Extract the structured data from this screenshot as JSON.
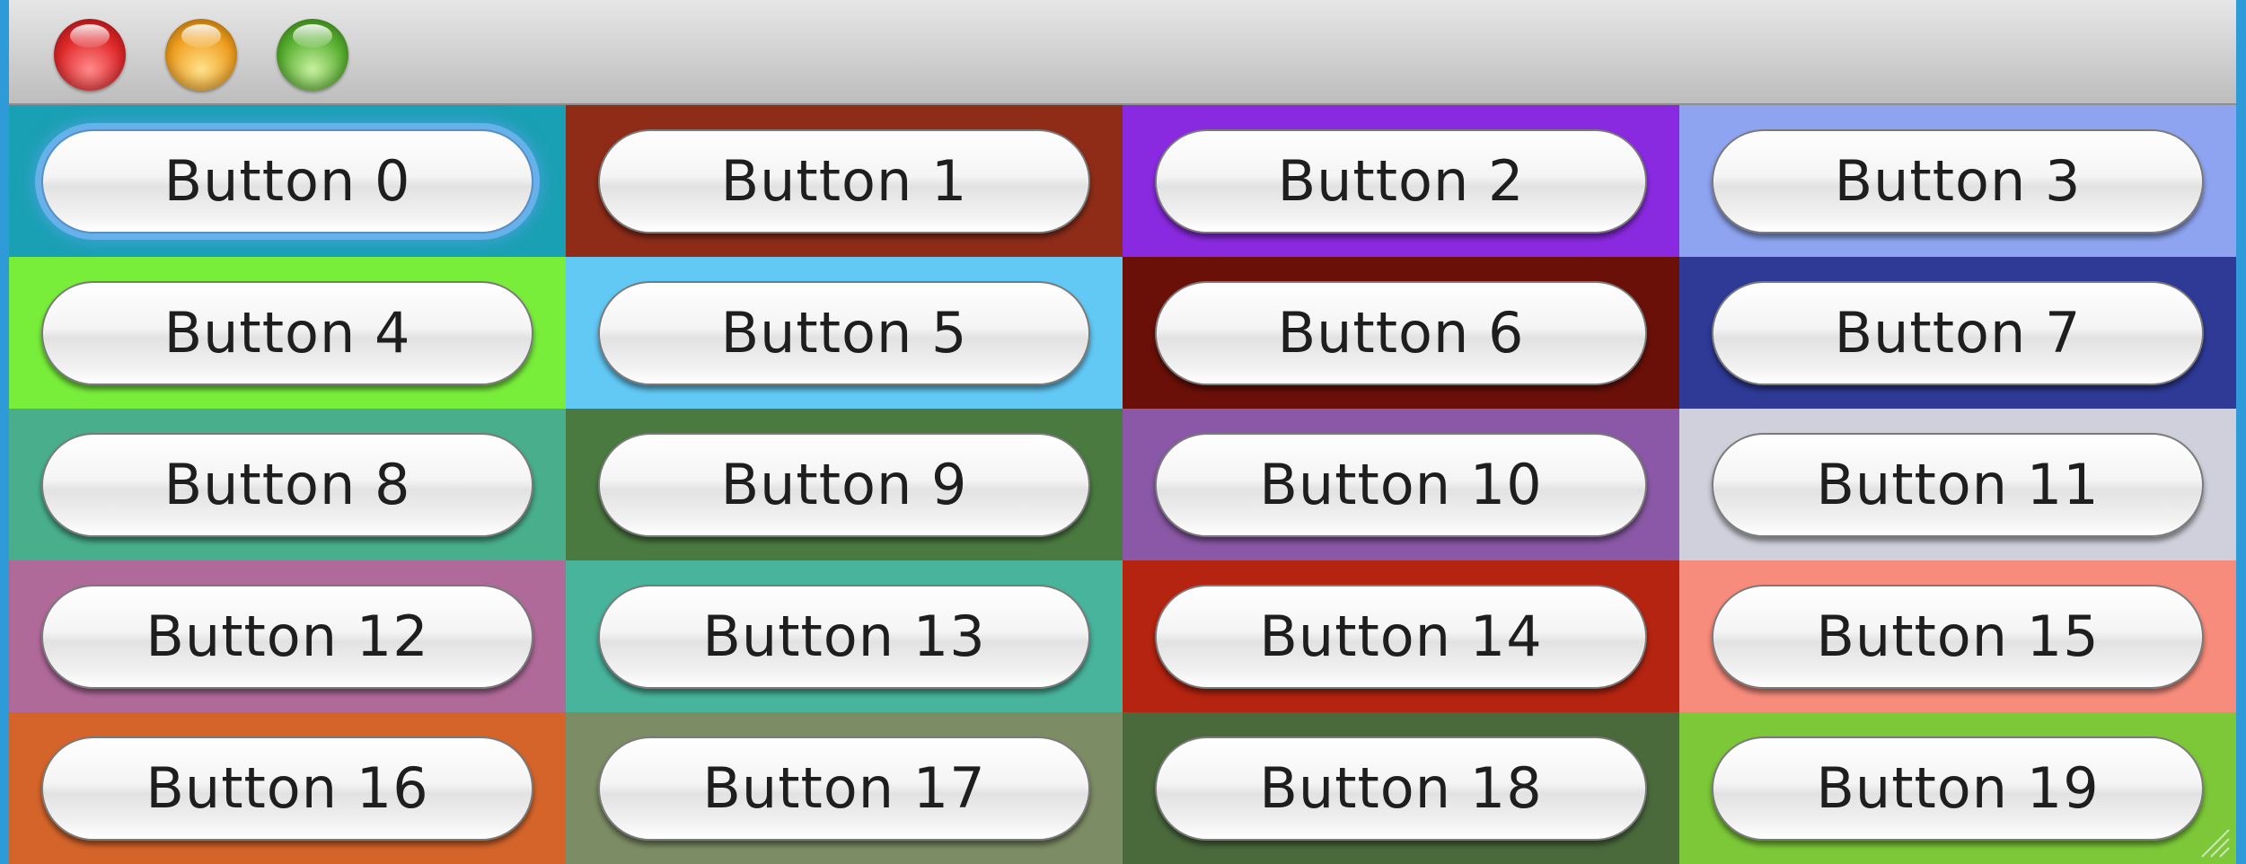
{
  "window": {
    "controls": [
      {
        "name": "close",
        "color": "#e0282a"
      },
      {
        "name": "minimize",
        "color": "#f0a020"
      },
      {
        "name": "zoom",
        "color": "#58b030"
      }
    ]
  },
  "focused_index": 0,
  "buttons": [
    {
      "label": "Button 0",
      "bg": "#1aa0b4"
    },
    {
      "label": "Button 1",
      "bg": "#8e2c18"
    },
    {
      "label": "Button 2",
      "bg": "#8a2ae0"
    },
    {
      "label": "Button 3",
      "bg": "#8ea4f0"
    },
    {
      "label": "Button 4",
      "bg": "#78ee3a"
    },
    {
      "label": "Button 5",
      "bg": "#62c8f4"
    },
    {
      "label": "Button 6",
      "bg": "#6a1008"
    },
    {
      "label": "Button 7",
      "bg": "#2e3a96"
    },
    {
      "label": "Button 8",
      "bg": "#48ae8c"
    },
    {
      "label": "Button 9",
      "bg": "#4a7a40"
    },
    {
      "label": "Button 10",
      "bg": "#8a58a6"
    },
    {
      "label": "Button 11",
      "bg": "#d0d0dc"
    },
    {
      "label": "Button 12",
      "bg": "#b06a9a"
    },
    {
      "label": "Button 13",
      "bg": "#48b49c"
    },
    {
      "label": "Button 14",
      "bg": "#b42410"
    },
    {
      "label": "Button 15",
      "bg": "#f88c7c"
    },
    {
      "label": "Button 16",
      "bg": "#d4642a"
    },
    {
      "label": "Button 17",
      "bg": "#7c8c64"
    },
    {
      "label": "Button 18",
      "bg": "#4a6a3c"
    },
    {
      "label": "Button 19",
      "bg": "#7cc838"
    }
  ]
}
